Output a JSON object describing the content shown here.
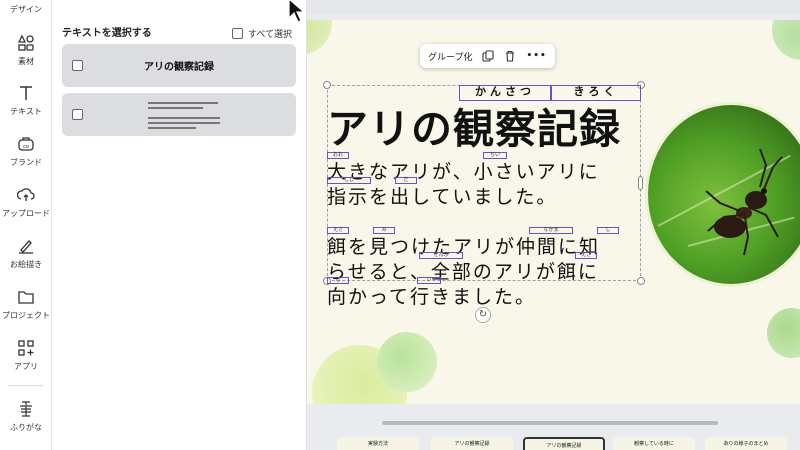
{
  "rail": {
    "top_label": "デザイン",
    "items": [
      {
        "label": "素材",
        "icon": "elements-icon"
      },
      {
        "label": "テキスト",
        "icon": "text-icon"
      },
      {
        "label": "ブランド",
        "icon": "brand-icon"
      },
      {
        "label": "アップロード",
        "icon": "upload-icon"
      },
      {
        "label": "お絵描き",
        "icon": "draw-icon"
      },
      {
        "label": "プロジェクト",
        "icon": "folder-icon"
      },
      {
        "label": "アプリ",
        "icon": "apps-icon"
      },
      {
        "label": "ふりがな",
        "icon": "furigana-icon"
      }
    ]
  },
  "panel": {
    "title": "テキストを選択する",
    "select_all": "すべて選択",
    "card1_text": "アリの観察記録"
  },
  "toolbar": {
    "group_label": "グループ化",
    "more": "•••"
  },
  "slide": {
    "title": "アリの観察記録",
    "ruby_title_1": "かんさつ",
    "ruby_title_2": "きろく",
    "line1": "大きなアリが、小さいアリに",
    "line2": "指示を出していました。",
    "line3": "餌を見つけたアリが仲間に知",
    "line4": "らせると、全部のアリが餌に",
    "line5": "向かって行きました。",
    "r1": "おお",
    "r2": "ちい",
    "r3": "しじ",
    "r4": "だ",
    "r5": "えさ",
    "r6": "み",
    "r7": "なかま",
    "r8": "し",
    "r9": "ぜんぶ",
    "r10": "えさ",
    "r11": "む",
    "r12": "い"
  },
  "thumbs": [
    {
      "label": "実験方法"
    },
    {
      "label": "アリの観察記録"
    },
    {
      "label": "アリの観察記録"
    },
    {
      "label": "観察している時に"
    },
    {
      "label": "ありの様子のまとめ"
    }
  ],
  "colors": {
    "accent": "#6a4fd0",
    "slide_bg": "#f8f7e9"
  }
}
